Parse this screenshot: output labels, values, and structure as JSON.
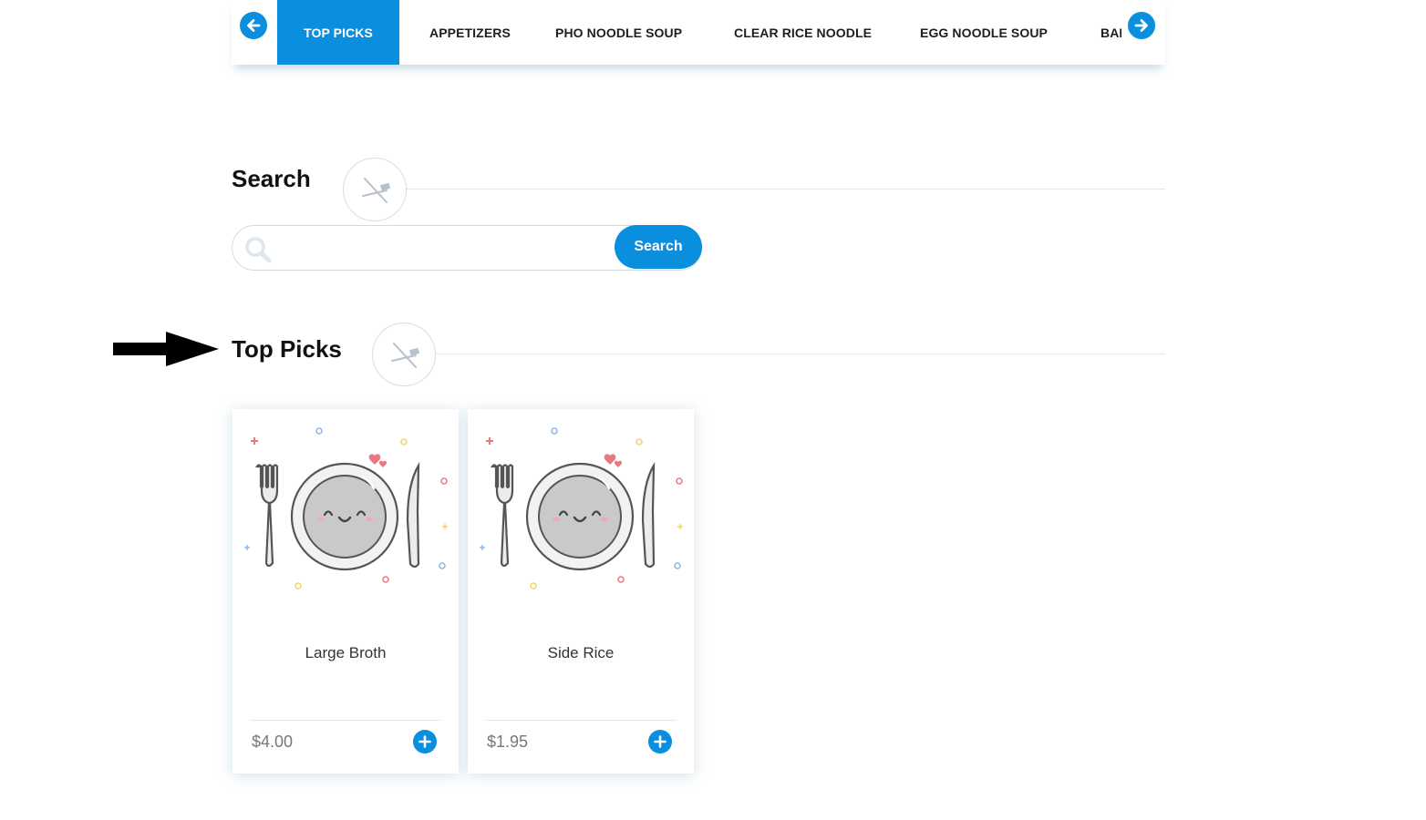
{
  "category_nav": {
    "tabs": [
      {
        "label": "TOP PICKS",
        "active": true
      },
      {
        "label": "APPETIZERS",
        "active": false
      },
      {
        "label": "PHO NOODLE SOUP",
        "active": false
      },
      {
        "label": "CLEAR RICE NOODLE",
        "active": false
      },
      {
        "label": "EGG NOODLE SOUP",
        "active": false
      },
      {
        "label": "BAI",
        "active": false
      }
    ],
    "prev_icon": "arrow-left-icon",
    "next_icon": "arrow-right-icon",
    "accent_color": "#0a8fdf"
  },
  "search_section": {
    "title": "Search",
    "input_value": "",
    "button_label": "Search",
    "icon": "search-icon"
  },
  "top_picks_section": {
    "title": "Top Picks",
    "items": [
      {
        "name": "Large Broth",
        "price": "$4.00",
        "image_icon": "smiling-plate-icon"
      },
      {
        "name": "Side Rice",
        "price": "$1.95",
        "image_icon": "smiling-plate-icon"
      }
    ],
    "add_icon": "plus-circle-icon"
  }
}
